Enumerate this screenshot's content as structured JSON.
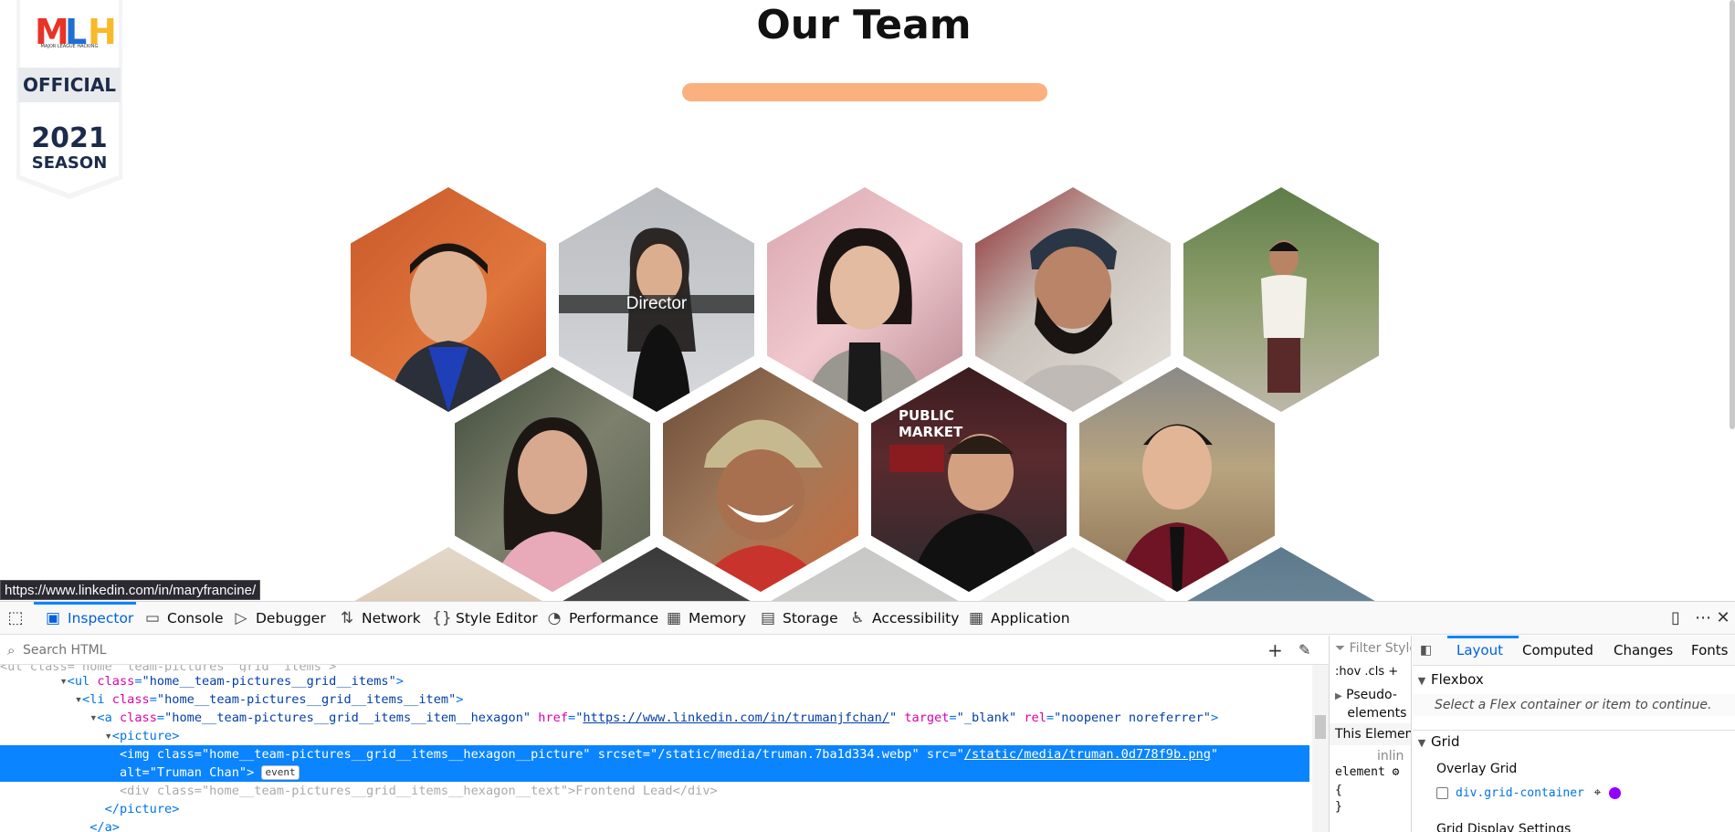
{
  "page": {
    "title": "Our Team",
    "badge": {
      "line1": "MLH",
      "line2": "MAJOR LEAGUE HACKING",
      "line3": "OFFICIAL",
      "line4": "2021",
      "line5": "SEASON"
    },
    "hover_label": "Director",
    "status_url": "https://www.linkedin.com/in/maryfrancine/",
    "accent_color": "#fbb07f"
  },
  "devtools": {
    "tabs": [
      {
        "label": "Inspector",
        "icon": "inspector-icon"
      },
      {
        "label": "Console",
        "icon": "console-icon"
      },
      {
        "label": "Debugger",
        "icon": "debugger-icon"
      },
      {
        "label": "Network",
        "icon": "network-icon"
      },
      {
        "label": "Style Editor",
        "icon": "style-editor-icon"
      },
      {
        "label": "Performance",
        "icon": "performance-icon"
      },
      {
        "label": "Memory",
        "icon": "memory-icon"
      },
      {
        "label": "Storage",
        "icon": "storage-icon"
      },
      {
        "label": "Accessibility",
        "icon": "accessibility-icon"
      },
      {
        "label": "Application",
        "icon": "application-icon"
      }
    ],
    "search_placeholder": "Search HTML",
    "tree": {
      "line0": "<ul class=\"home__team-pictures__grid__items\">",
      "line1_tag_open": "<ul ",
      "line1_attr": "class",
      "line1_val": "\"home__team-pictures__grid__items\"",
      "line2_attr": "class",
      "line2_val": "\"home__team-pictures__grid__items__item\"",
      "line3_class_val": "\"home__team-pictures__grid__items__item__hexagon\"",
      "line3_href_val": "https://www.linkedin.com/in/trumanjfchan/",
      "line3_target_val": "\"_blank\"",
      "line3_rel_val": "\"noopener noreferrer\"",
      "line4": "<picture>",
      "line5_class_val": "\"home__team-pictures__grid__items__hexagon__picture\"",
      "line5_srcset_val": "\"/static/media/truman.7ba1d334.webp\"",
      "line5_src_val": "/static/media/truman.0d778f9b.png",
      "line6_alt_val": "\"Truman Chan\"",
      "event_badge": "event",
      "line7_class_val": "\"home__team-pictures__grid__items__hexagon__text\"",
      "line7_text": "Frontend Lead",
      "line8": "</picture>",
      "line9": "</a>"
    },
    "rules": {
      "filter_placeholder": "Filter Style",
      "hov": ":hov",
      "cls": ".cls",
      "pseudo1": "Pseudo-",
      "pseudo2": "elements",
      "this_element": "This Element",
      "inline": "inlin",
      "element": "element",
      "brace_open": "{",
      "brace_close": "}"
    },
    "layout": {
      "tabs": [
        "Layout",
        "Computed",
        "Changes",
        "Fonts"
      ],
      "flexbox": "Flexbox",
      "flex_hint": "Select a Flex container or item to continue.",
      "grid": "Grid",
      "overlay_grid": "Overlay Grid",
      "grid_container": "div.grid-container",
      "grid_color": "#9400ff",
      "grid_display_settings": "Grid Display Settings"
    }
  }
}
